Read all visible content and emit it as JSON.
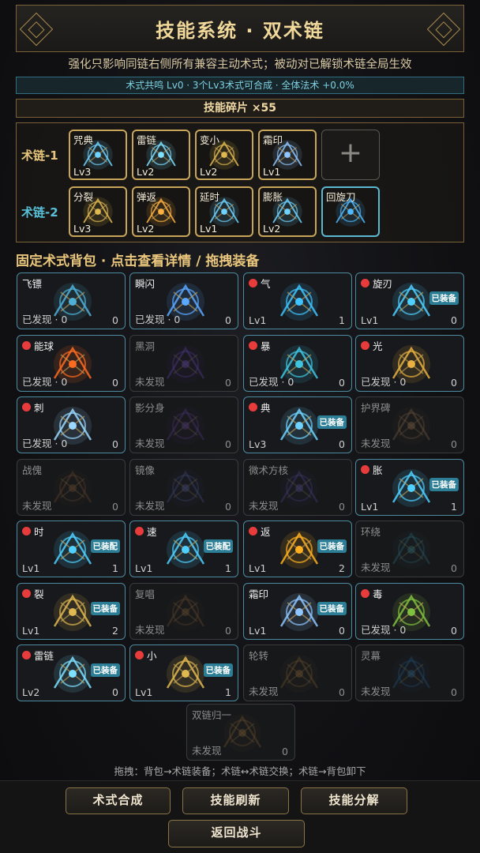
{
  "header": {
    "title": "技能系统 · 双术链"
  },
  "subtitle": "强化只影响同链右侧所有兼容主动术式；被动对已解锁术链全局生效",
  "resonance": "术式共鸣 Lv0 · 3个Lv3术式可合成 · 全体法术 +0.0%",
  "shards": "技能碎片 ×55",
  "chains": [
    {
      "label": "术链-1",
      "slots": [
        {
          "name": "咒典",
          "level": "Lv3",
          "icon": "grimoire-icon",
          "color": "#6fd3ff"
        },
        {
          "name": "雷链",
          "level": "Lv2",
          "icon": "lightning-chain-icon",
          "color": "#7ee0ff"
        },
        {
          "name": "变小",
          "level": "Lv2",
          "icon": "shrink-diamond-icon",
          "color": "#e0b850"
        },
        {
          "name": "霜印",
          "level": "Lv1",
          "icon": "frost-seal-icon",
          "color": "#8fc6ff"
        }
      ],
      "add_label": "+"
    },
    {
      "label": "术链-2",
      "slots": [
        {
          "name": "分裂",
          "level": "Lv3",
          "icon": "split-icon",
          "color": "#e0b850"
        },
        {
          "name": "弹返",
          "level": "Lv2",
          "icon": "bounce-icon",
          "color": "#ffb040"
        },
        {
          "name": "延时",
          "level": "Lv1",
          "icon": "delay-clock-icon",
          "color": "#6fd3ff"
        },
        {
          "name": "膨胀",
          "level": "Lv2",
          "icon": "expand-orb-icon",
          "color": "#6fd3ff"
        },
        {
          "name": "回旋刀",
          "level": "",
          "icon": "boomerang-blade-icon",
          "color": "#4fb8ff"
        }
      ]
    }
  ],
  "bag_title": "固定术式背包 · 点击查看详情 / 拖拽装备",
  "cards": [
    {
      "name": "飞镖",
      "dot": false,
      "status": "已发现 · 0",
      "count": "0",
      "state": "found",
      "icon": "dart-icon",
      "color": "#4fb0d8",
      "equipped": ""
    },
    {
      "name": "瞬闪",
      "dot": false,
      "status": "已发现 · 0",
      "count": "0",
      "state": "found",
      "icon": "flash-blade-icon",
      "color": "#5aa8ff",
      "equipped": ""
    },
    {
      "name": "气",
      "dot": true,
      "status": "Lv1",
      "count": "1",
      "state": "found",
      "icon": "air-crescent-icon",
      "color": "#3fc4ff",
      "equipped": ""
    },
    {
      "name": "旋刃",
      "dot": true,
      "status": "Lv1",
      "count": "0",
      "state": "found",
      "icon": "spin-blade-icon",
      "color": "#4fd0ff",
      "equipped": "已装备"
    },
    {
      "name": "能球",
      "dot": true,
      "status": "已发现 · 0",
      "count": "0",
      "state": "found",
      "icon": "energy-orb-icon",
      "color": "#ff6a20",
      "equipped": ""
    },
    {
      "name": "黑洞",
      "dot": false,
      "status": "未发现",
      "count": "0",
      "state": "locked",
      "icon": "black-hole-icon",
      "color": "#8a5cff",
      "equipped": ""
    },
    {
      "name": "暴",
      "dot": true,
      "status": "已发现 · 0",
      "count": "0",
      "state": "found",
      "icon": "storm-icon",
      "color": "#3fc4e0",
      "equipped": ""
    },
    {
      "name": "光",
      "dot": true,
      "status": "已发现 · 0",
      "count": "0",
      "state": "found",
      "icon": "light-beam-icon",
      "color": "#e8b040",
      "equipped": ""
    },
    {
      "name": "刺",
      "dot": true,
      "status": "已发现 · 0",
      "count": "0",
      "state": "found",
      "icon": "spike-icon",
      "color": "#9ad8ff",
      "equipped": ""
    },
    {
      "name": "影分身",
      "dot": false,
      "status": "未发现",
      "count": "0",
      "state": "locked",
      "icon": "shadow-clone-icon",
      "color": "#7a50c0",
      "equipped": ""
    },
    {
      "name": "典",
      "dot": true,
      "status": "Lv3",
      "count": "0",
      "state": "found",
      "icon": "grimoire-icon",
      "color": "#6fd3ff",
      "equipped": "已装备"
    },
    {
      "name": "护界碑",
      "dot": false,
      "status": "未发现",
      "count": "0",
      "state": "locked",
      "icon": "barrier-stele-icon",
      "color": "#c09060",
      "equipped": ""
    },
    {
      "name": "战傀",
      "dot": false,
      "status": "未发现",
      "count": "0",
      "state": "locked",
      "icon": "war-golem-icon",
      "color": "#a06a40",
      "equipped": ""
    },
    {
      "name": "镜像",
      "dot": false,
      "status": "未发现",
      "count": "0",
      "state": "locked",
      "icon": "mirror-icon",
      "color": "#6070c0",
      "equipped": ""
    },
    {
      "name": "微术方核",
      "dot": false,
      "status": "未发现",
      "count": "0",
      "state": "locked",
      "icon": "micro-core-icon",
      "color": "#7060d0",
      "equipped": ""
    },
    {
      "name": "胀",
      "dot": true,
      "status": "Lv1",
      "count": "1",
      "state": "found",
      "icon": "expand-orb-icon",
      "color": "#4fd0ff",
      "equipped": "已装备"
    },
    {
      "name": "时",
      "dot": true,
      "status": "Lv1",
      "count": "1",
      "state": "found",
      "icon": "time-spiral-icon",
      "color": "#4fd0ff",
      "equipped": "已装配"
    },
    {
      "name": "速",
      "dot": true,
      "status": "Lv1",
      "count": "1",
      "state": "found",
      "icon": "winged-speed-icon",
      "color": "#4fd0ff",
      "equipped": "已装配"
    },
    {
      "name": "返",
      "dot": true,
      "status": "Lv1",
      "count": "2",
      "state": "found",
      "icon": "return-arrow-icon",
      "color": "#ffb020",
      "equipped": "已装备"
    },
    {
      "name": "环绕",
      "dot": false,
      "status": "未发现",
      "count": "0",
      "state": "locked",
      "icon": "orbit-ring-icon",
      "color": "#3aa0b0",
      "equipped": ""
    },
    {
      "name": "裂",
      "dot": true,
      "status": "Lv1",
      "count": "2",
      "state": "found",
      "icon": "split-icon",
      "color": "#e0b850",
      "equipped": "已装备"
    },
    {
      "name": "复唱",
      "dot": false,
      "status": "未发现",
      "count": "0",
      "state": "locked",
      "icon": "recast-gears-icon",
      "color": "#a07040",
      "equipped": ""
    },
    {
      "name": "霜印",
      "dot": false,
      "status": "Lv1",
      "count": "0",
      "state": "found",
      "icon": "frost-seal-icon",
      "color": "#8fc6ff",
      "equipped": "已装备"
    },
    {
      "name": "毒",
      "dot": true,
      "status": "已发现 · 0",
      "count": "0",
      "state": "found",
      "icon": "poison-icon",
      "color": "#80c040",
      "equipped": ""
    },
    {
      "name": "雷链",
      "dot": true,
      "status": "Lv2",
      "count": "0",
      "state": "found",
      "icon": "lightning-chain-icon",
      "color": "#7ee0ff",
      "equipped": "已装备"
    },
    {
      "name": "小",
      "dot": true,
      "status": "Lv1",
      "count": "1",
      "state": "found",
      "icon": "shrink-diamond-icon",
      "color": "#e0b850",
      "equipped": "已装备"
    },
    {
      "name": "轮转",
      "dot": false,
      "status": "未发现",
      "count": "0",
      "state": "locked",
      "icon": "rotation-icon",
      "color": "#b08040",
      "equipped": ""
    },
    {
      "name": "灵幕",
      "dot": false,
      "status": "未发现",
      "count": "0",
      "state": "locked",
      "icon": "spirit-veil-icon",
      "color": "#3080c0",
      "equipped": ""
    },
    {
      "name": "双链归一",
      "dot": false,
      "status": "未发现",
      "count": "0",
      "state": "locked",
      "icon": "twin-chain-icon",
      "color": "#b08040",
      "equipped": ""
    }
  ],
  "help": "拖拽：背包→术链装备；术链↔术链交换；术链→背包卸下",
  "buttons": {
    "synth": "术式合成",
    "refresh": "技能刷新",
    "decompose": "技能分解",
    "back": "返回战斗"
  }
}
